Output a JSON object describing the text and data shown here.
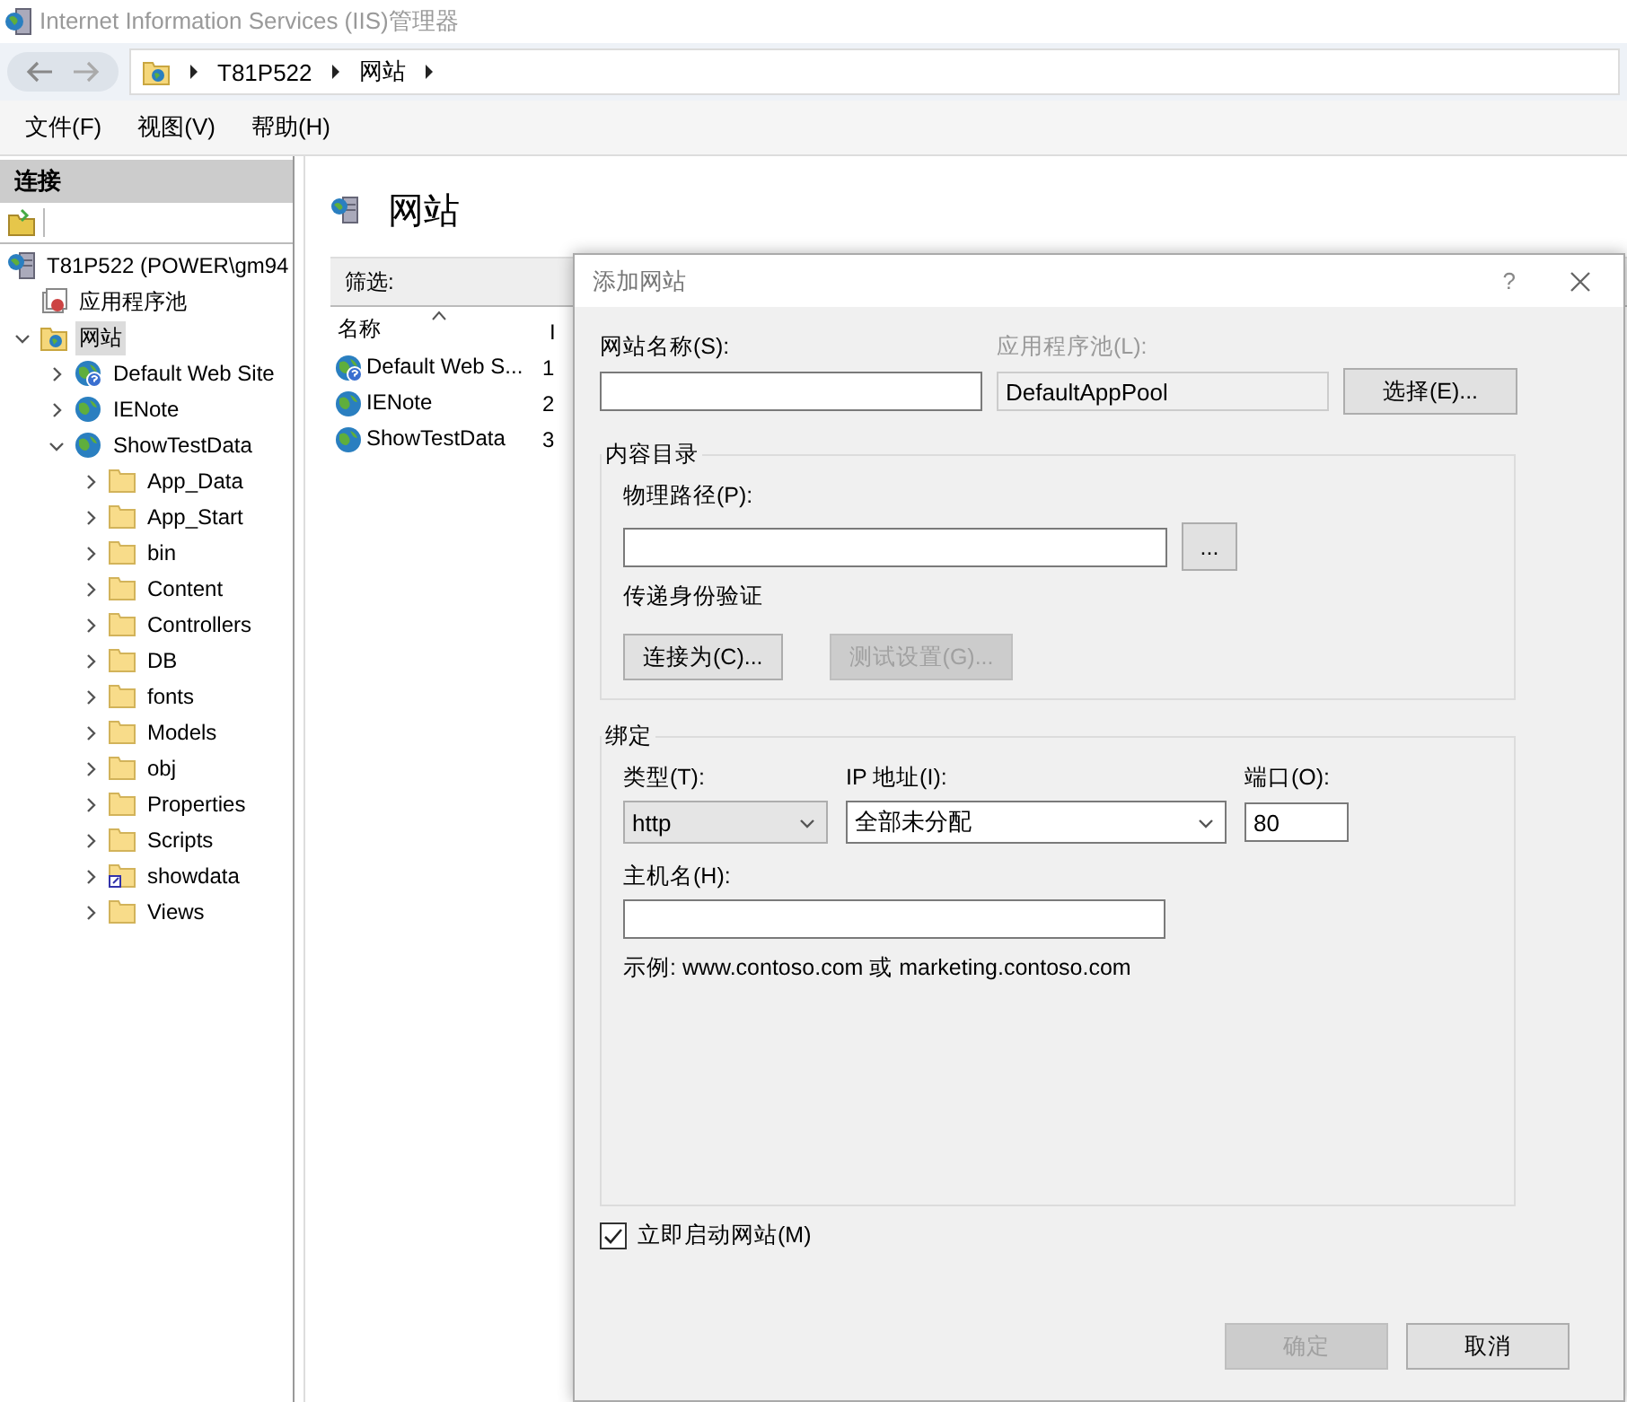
{
  "window": {
    "title": "Internet Information Services (IIS)管理器"
  },
  "address_bar": {
    "path": [
      "T81P522",
      "网站"
    ]
  },
  "menu": [
    "文件(F)",
    "视图(V)",
    "帮助(H)"
  ],
  "connections": {
    "title": "连接",
    "tree": [
      {
        "label": "T81P522 (POWER\\gm94",
        "kind": "server",
        "selected": false,
        "children": [
          {
            "label": "应用程序池",
            "kind": "pool",
            "selected": false
          },
          {
            "label": "网站",
            "kind": "sites",
            "expanded": true,
            "selected": true,
            "children": [
              {
                "label": "Default Web Site",
                "kind": "site-unknown",
                "expanded": false,
                "selected": false
              },
              {
                "label": "IENote",
                "kind": "site",
                "expanded": false,
                "selected": false
              },
              {
                "label": "ShowTestData",
                "kind": "site",
                "expanded": true,
                "selected": false,
                "children": [
                  {
                    "label": "App_Data",
                    "kind": "folder",
                    "expanded": false,
                    "selected": false
                  },
                  {
                    "label": "App_Start",
                    "kind": "folder",
                    "expanded": false,
                    "selected": false
                  },
                  {
                    "label": "bin",
                    "kind": "folder",
                    "expanded": false,
                    "selected": false
                  },
                  {
                    "label": "Content",
                    "kind": "folder",
                    "expanded": false,
                    "selected": false
                  },
                  {
                    "label": "Controllers",
                    "kind": "folder",
                    "expanded": false,
                    "selected": false
                  },
                  {
                    "label": "DB",
                    "kind": "folder",
                    "expanded": false,
                    "selected": false
                  },
                  {
                    "label": "fonts",
                    "kind": "folder",
                    "expanded": false,
                    "selected": false
                  },
                  {
                    "label": "Models",
                    "kind": "folder",
                    "expanded": false,
                    "selected": false
                  },
                  {
                    "label": "obj",
                    "kind": "folder",
                    "expanded": false,
                    "selected": false
                  },
                  {
                    "label": "Properties",
                    "kind": "folder",
                    "expanded": false,
                    "selected": false
                  },
                  {
                    "label": "Scripts",
                    "kind": "folder",
                    "expanded": false,
                    "selected": false
                  },
                  {
                    "label": "showdata",
                    "kind": "shortcut",
                    "expanded": false,
                    "selected": false
                  },
                  {
                    "label": "Views",
                    "kind": "folder",
                    "expanded": false,
                    "selected": false
                  }
                ]
              }
            ]
          }
        ]
      }
    ]
  },
  "main": {
    "title": "网站",
    "filter_label": "筛选:",
    "columns": [
      "名称",
      "I"
    ],
    "rows": [
      {
        "name": "Default Web S...",
        "id": "1",
        "kind": "site-unknown"
      },
      {
        "name": "IENote",
        "id": "2",
        "kind": "site"
      },
      {
        "name": "ShowTestData",
        "id": "3",
        "kind": "site"
      }
    ]
  },
  "dialog": {
    "title": "添加网站",
    "help": "?",
    "site_name": {
      "label": "网站名称(S):"
    },
    "app_pool": {
      "label": "应用程序池(L):",
      "value": "DefaultAppPool",
      "disabled": true
    },
    "select_button": "选择(E)...",
    "content": {
      "title": "内容目录",
      "path_label": "物理路径(P):",
      "browse_button": "...",
      "auth_label": "传递身份验证",
      "buttons": [
        {
          "label": "连接为(C)...",
          "disabled": false
        },
        {
          "label": "测试设置(G)...",
          "disabled": true
        }
      ]
    },
    "binding": {
      "title": "绑定",
      "type_label": "类型(T):",
      "type_value": "http",
      "ip_label": "IP 地址(I):",
      "ip_value": "全部未分配",
      "port_label": "端口(O):",
      "port_value": "80",
      "host_label": "主机名(H):",
      "example": "示例: www.contoso.com 或 marketing.contoso.com"
    },
    "start_checkbox": {
      "label": "立即启动网站(M)",
      "checked": true
    },
    "buttons": [
      {
        "label": "确定",
        "disabled": true
      },
      {
        "label": "取消",
        "disabled": false
      }
    ]
  }
}
